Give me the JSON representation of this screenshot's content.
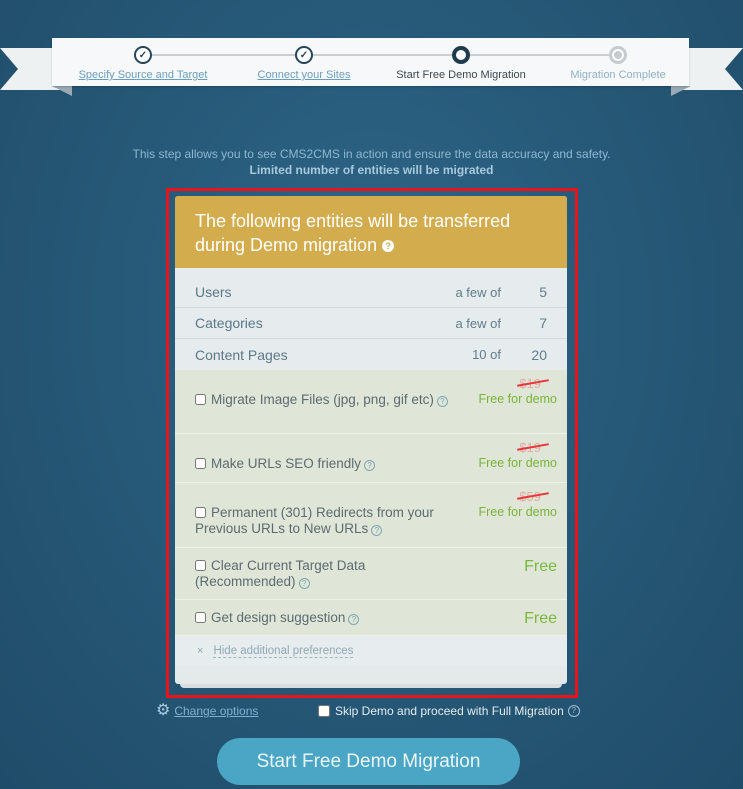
{
  "steps": [
    {
      "label": "Specify Source and Target",
      "state": "done",
      "icon": "check-icon"
    },
    {
      "label": "Connect your Sites",
      "state": "done",
      "icon": "check-icon"
    },
    {
      "label": "Start Free Demo Migration",
      "state": "current",
      "icon": "ring-icon"
    },
    {
      "label": "Migration Complete",
      "state": "future",
      "icon": "dot-icon"
    }
  ],
  "intro": {
    "line1": "This step allows you to see CMS2CMS in action and ensure the data accuracy and safety.",
    "line2": "Limited number of entities will be migrated"
  },
  "card": {
    "title": "The following entities will be transferred during Demo migration",
    "help": "?",
    "entities": [
      {
        "name": "Users",
        "amount": "a few of",
        "total": "5"
      },
      {
        "name": "Categories",
        "amount": "a few of",
        "total": "7"
      },
      {
        "name": "Content Pages",
        "amount": "10 of",
        "total": "20"
      }
    ],
    "options": [
      {
        "label": "Migrate Image Files (jpg, png, gif etc)",
        "old_price": "$19",
        "price": "Free for demo",
        "checked": false
      },
      {
        "label": "Make URLs SEO friendly",
        "old_price": "$19",
        "price": "Free for demo",
        "checked": false
      },
      {
        "label": "Permanent (301) Redirects from your Previous URLs to New URLs",
        "old_price": "$59",
        "price": "Free for demo",
        "checked": false
      },
      {
        "label": "Clear Current Target Data (Recommended)",
        "old_price": "",
        "price": "Free",
        "checked": false
      },
      {
        "label": "Get design suggestion",
        "old_price": "",
        "price": "Free",
        "checked": false
      }
    ],
    "hide_link": "Hide additional preferences",
    "close_glyph": "×"
  },
  "below": {
    "change_options": "Change options",
    "skip_label": "Skip Demo and proceed with Full Migration"
  },
  "start_button": "Start Free Demo Migration",
  "colors": {
    "background": "#275a79",
    "header": "#d3ac4e",
    "button": "#4aa6c4",
    "highlight": "#e8141c",
    "free_text": "#78b33a"
  }
}
